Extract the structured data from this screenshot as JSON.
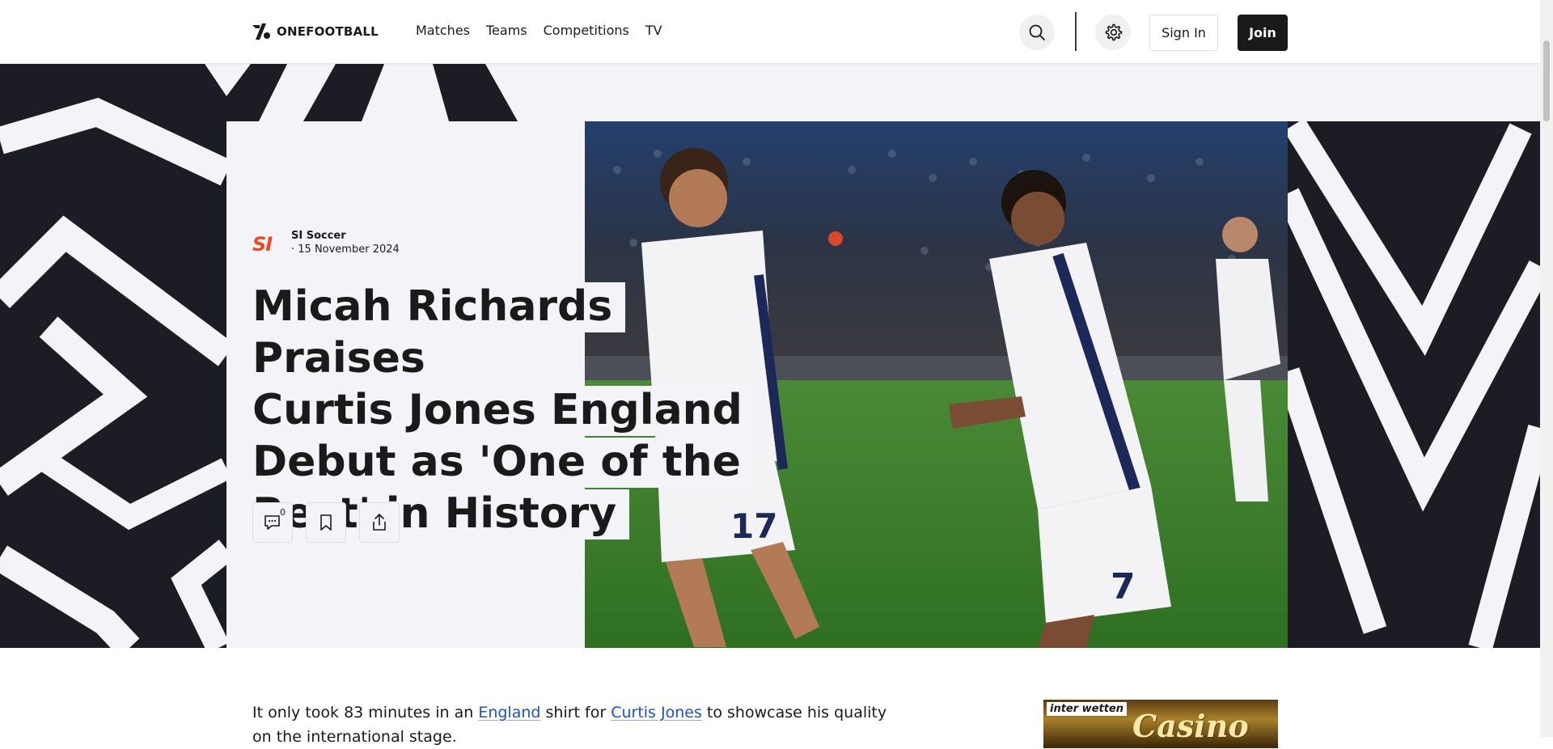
{
  "header": {
    "logo_text": "ONEFOOTBALL",
    "nav": [
      "Matches",
      "Teams",
      "Competitions",
      "TV"
    ],
    "sign_in_label": "Sign In",
    "join_label": "Join",
    "search_icon": "search-icon",
    "settings_icon": "gear-icon"
  },
  "article": {
    "source_logo": "SI",
    "source_name": "SI Soccer",
    "date": "15 November 2024",
    "headline_lines": [
      "Micah Richards Praises",
      "Curtis Jones England",
      "Debut as 'One of the",
      "Best' in History"
    ],
    "comment_count": "0",
    "actions": [
      "comment-icon",
      "bookmark-icon",
      "share-icon"
    ],
    "body": {
      "text_1": "It only took 83 minutes in an ",
      "link_1": "England",
      "text_2": " shirt for ",
      "link_2": "Curtis Jones",
      "text_3": " to showcase his quality on the international stage."
    }
  },
  "ad": {
    "logo": "inter wetten",
    "text": "Casino"
  },
  "colors": {
    "brand_dark": "#1a1a1a",
    "hero_bg": "#f4f4f8",
    "link": "#1f4fd1",
    "source_accent": "#e84a2b"
  }
}
